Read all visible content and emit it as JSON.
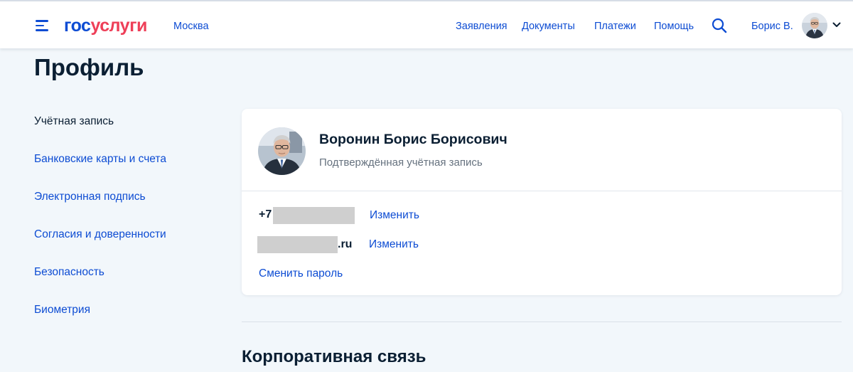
{
  "header": {
    "logo_part1": "гос",
    "logo_part2": "услуги",
    "city": "Москва",
    "nav": [
      "Заявления",
      "Документы",
      "Платежи",
      "Помощь"
    ],
    "user_name": "Борис В.",
    "icons": [
      "menu-icon",
      "search-icon",
      "chevron-down-icon"
    ]
  },
  "page": {
    "title": "Профиль"
  },
  "sidebar": {
    "items": [
      {
        "label": "Учётная запись",
        "active": true
      },
      {
        "label": "Банковские карты и счета",
        "active": false
      },
      {
        "label": "Электронная подпись",
        "active": false
      },
      {
        "label": "Согласия и доверенности",
        "active": false
      },
      {
        "label": "Безопасность",
        "active": false
      },
      {
        "label": "Биометрия",
        "active": false
      }
    ]
  },
  "profile": {
    "full_name": "Воронин Борис Борисович",
    "status": "Подтверждённая учётная запись",
    "phone_prefix": "+7",
    "email_suffix": ".ru",
    "change_label": "Изменить",
    "change_password": "Сменить пароль"
  },
  "sections": {
    "corporate_title": "Корпоративная связь"
  },
  "colors": {
    "brand_blue": "#0d4cd3",
    "brand_red": "#ee3f58",
    "text_dark": "#0b1f33",
    "text_secondary": "#66727f",
    "page_bg": "#f2f7fb"
  }
}
